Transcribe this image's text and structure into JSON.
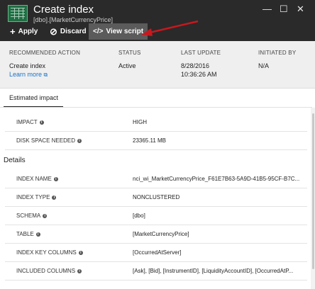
{
  "header": {
    "title": "Create index",
    "subtitle": "[dbo].[MarketCurrencyPrice]",
    "minimize_glyph": "—",
    "maximize_glyph": "☐",
    "close_glyph": "✕"
  },
  "toolbar": {
    "apply_label": "Apply",
    "discard_label": "Discard",
    "view_script_label": "View script"
  },
  "summary": {
    "headers": [
      "RECOMMENDED ACTION",
      "STATUS",
      "LAST UPDATE",
      "INITIATED BY"
    ],
    "action": "Create index",
    "learn_more": "Learn more",
    "status": "Active",
    "last_update_date": "8/28/2016",
    "last_update_time": "10:36:26 AM",
    "initiated_by": "N/A"
  },
  "tab": {
    "label": "Estimated impact"
  },
  "impact": [
    {
      "label": "IMPACT",
      "value": "HIGH"
    },
    {
      "label": "DISK SPACE NEEDED",
      "value": "23365.11 MB"
    }
  ],
  "details_heading": "Details",
  "details": [
    {
      "label": "INDEX NAME",
      "value": "nci_wi_MarketCurrencyPrice_F61E7B63-5A9D-41B5-95CF-B7C..."
    },
    {
      "label": "INDEX TYPE",
      "value": "NONCLUSTERED"
    },
    {
      "label": "SCHEMA",
      "value": "[dbo]"
    },
    {
      "label": "TABLE",
      "value": "[MarketCurrencyPrice]"
    },
    {
      "label": "INDEX KEY COLUMNS",
      "value": "[OccurredAtServer]"
    },
    {
      "label": "INCLUDED COLUMNS",
      "value": "[Ask], [Bid], [InstrumentID], [LiquidityAccountID], [OccurredAtP..."
    }
  ]
}
